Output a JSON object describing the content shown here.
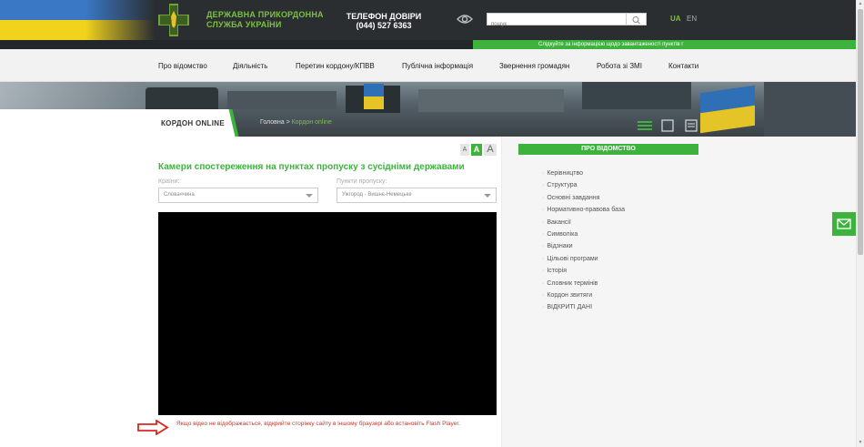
{
  "header": {
    "brand_line1": "ДЕРЖАВНА ПРИКОРДОННА",
    "brand_line2": "СЛУЖБА УКРАЇНИ",
    "hotline_title": "ТЕЛЕФОН ДОВІРИ",
    "hotline_number": "(044) 527 6363",
    "search_placeholder": "пошук",
    "lang_ua": "UA",
    "lang_en": "EN"
  },
  "ticker": {
    "text": "Слідкуйте за інформацією щодо завантаженості пунктів г"
  },
  "nav": {
    "items": [
      {
        "label": "Про відомство"
      },
      {
        "label": "Діяльність"
      },
      {
        "label": "Перетин кордону/КПВВ"
      },
      {
        "label": "Публічна інформація"
      },
      {
        "label": "Звернення громадян"
      },
      {
        "label": "Робота зі ЗМІ"
      },
      {
        "label": "Контакти"
      }
    ]
  },
  "breadcrumb": {
    "section_title": "КОРДОН ONLINE",
    "home": "Головна",
    "separator": ">",
    "current": "Кордон online"
  },
  "font_controls": {
    "small": "A",
    "medium": "A",
    "large": "A"
  },
  "main": {
    "heading": "Камери спостереження на пунктах пропуску з сусідніми державами",
    "country_label": "Країни:",
    "country_value": "Словаччина",
    "checkpoint_label": "Пункти пропуску:",
    "checkpoint_value": "Ужгород - Вишнє-Немецьке",
    "warning": "Якщо відео не відображається, відкрийте сторінку сайту в іншому браузері або встановіть Flash Player."
  },
  "sidebar": {
    "title": "ПРО ВІДОМСТВО",
    "items": [
      {
        "label": "Керівництво"
      },
      {
        "label": "Структура"
      },
      {
        "label": "Основні завдання"
      },
      {
        "label": "Нормативно-правова база"
      },
      {
        "label": "Вакансії"
      },
      {
        "label": "Символіка"
      },
      {
        "label": "Відзнаки"
      },
      {
        "label": "Цільові програми"
      },
      {
        "label": "Історія"
      },
      {
        "label": "Словник термінів"
      },
      {
        "label": "Кордон звитяги"
      },
      {
        "label": "ВІДКРИТІ ДАНІ"
      }
    ]
  },
  "colors": {
    "accent": "#3db33d",
    "header_bg": "#2b2e31",
    "warning": "#c0392b"
  },
  "icons": [
    "emblem-icon",
    "eye-icon",
    "search-icon",
    "view-grid-icon",
    "view-square-icon",
    "view-list-icon",
    "mail-icon",
    "arrow-right-icon"
  ]
}
